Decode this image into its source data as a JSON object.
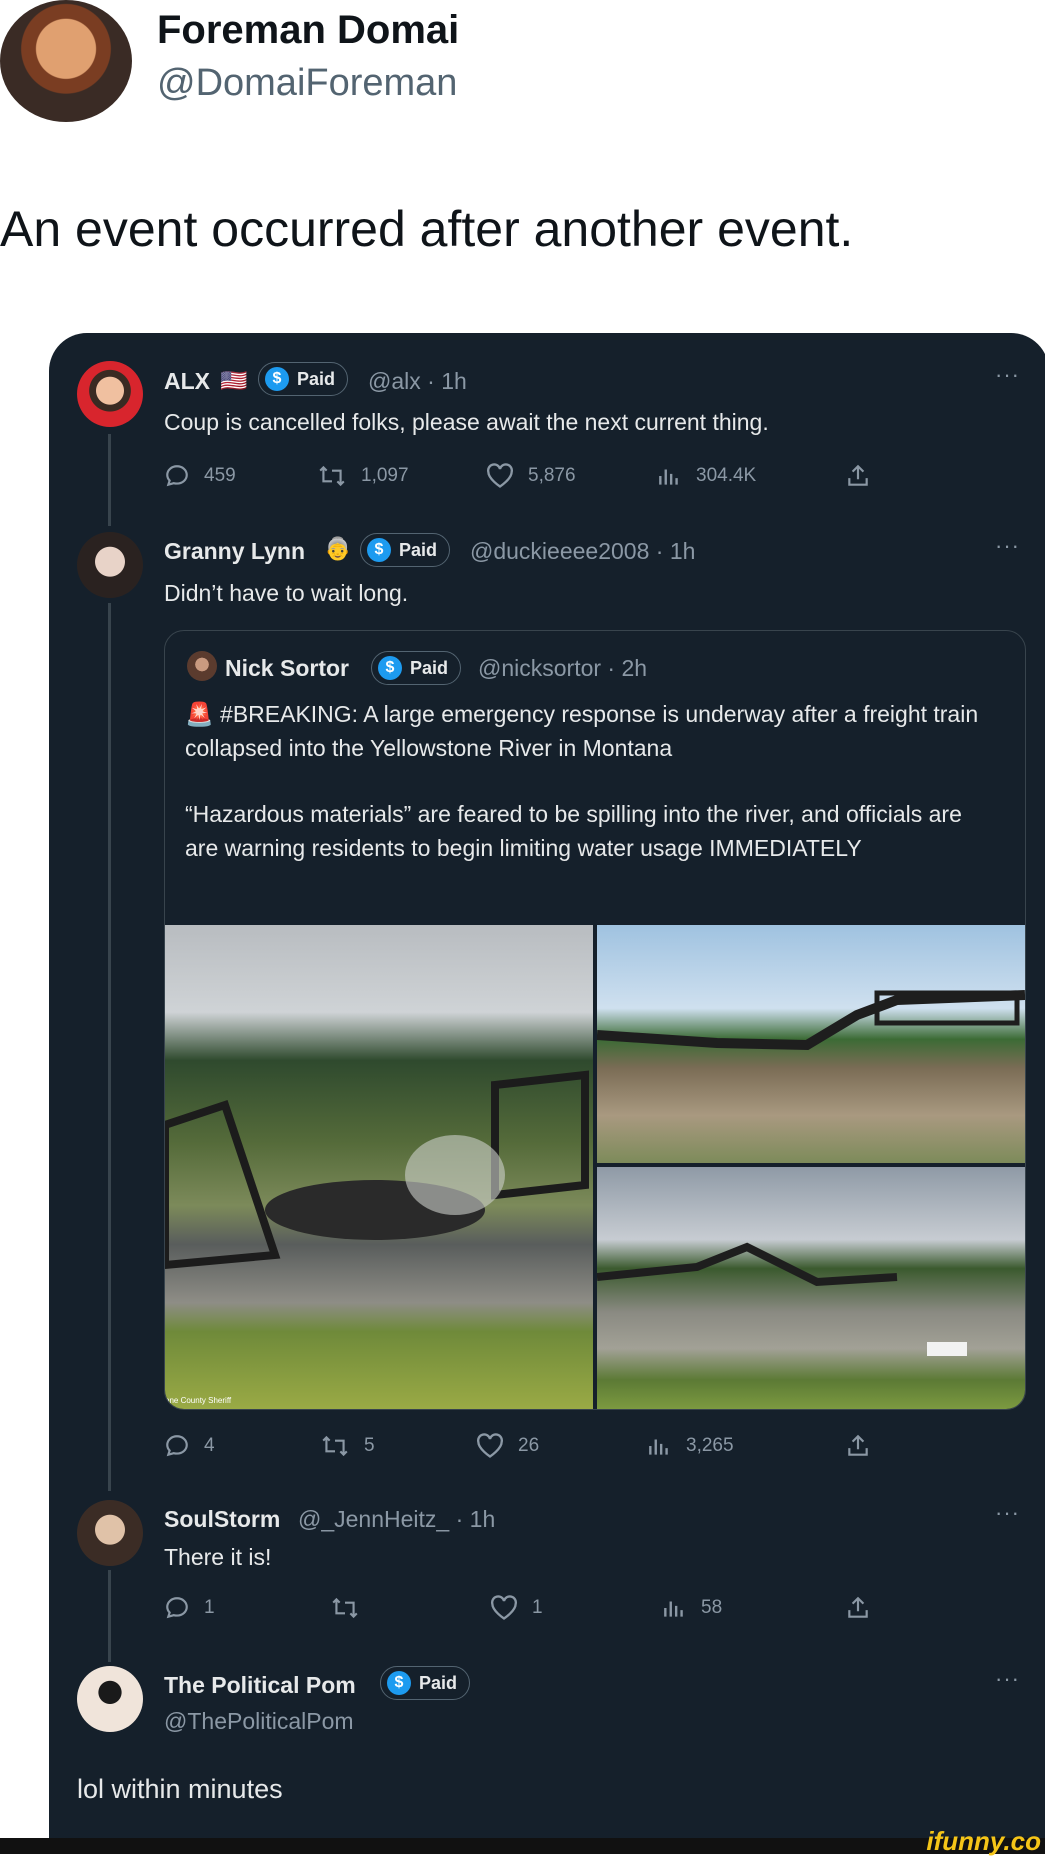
{
  "header": {
    "name": "Foreman Domai",
    "handle": "@DomaiForeman",
    "text": "An event occurred after another event."
  },
  "paid_label": "Paid",
  "tweets": [
    {
      "name": "ALX",
      "flag": "🇺🇸",
      "handle": "@alx · 1h",
      "text": "Coup is cancelled folks, please await the next current thing.",
      "replies": "459",
      "retweets": "1,097",
      "likes": "5,876",
      "views": "304.4K"
    },
    {
      "name": "Granny Lynn",
      "emoji": "👵",
      "handle": "@duckieeee2008 · 1h",
      "text": "Didn’t have to wait long.",
      "quote": {
        "name": "Nick Sortor",
        "handle": "@nicksortor · 2h",
        "text1": "🚨 #BREAKING: A large emergency response is underway after a freight train collapsed into the Yellowstone River in Montana",
        "text2": "“Hazardous materials” are feared to be spilling into the river, and officials are are warning residents to begin limiting water usage IMMEDIATELY",
        "image_caption": "one County Sheriff"
      },
      "replies": "4",
      "retweets": "5",
      "likes": "26",
      "views": "3,265"
    },
    {
      "name": "SoulStorm",
      "handle": "@_JennHeitz_ · 1h",
      "text": "There it is!",
      "replies": "1",
      "retweets": "",
      "likes": "1",
      "views": "58"
    },
    {
      "name": "The Political Pom",
      "handle": "@ThePoliticalPom",
      "text": "lol within minutes"
    }
  ],
  "more_label": "···",
  "watermark": "ifunny.co",
  "colors": {
    "panel": "#15202b",
    "paid_badge": "#1d9bf0",
    "muted": "#8b98a5"
  }
}
